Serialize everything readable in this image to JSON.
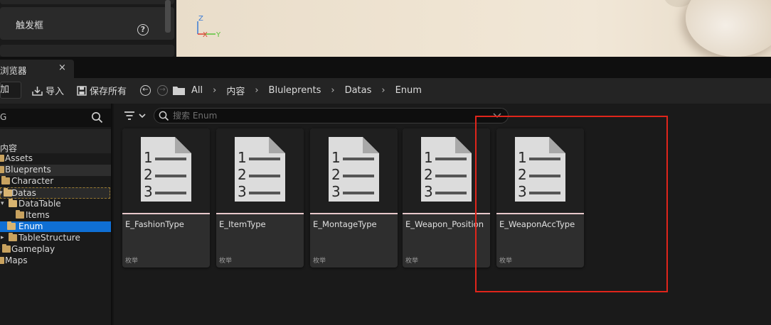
{
  "details_panel": {
    "trigger_label": "触发框",
    "help_icon": "help-icon"
  },
  "viewport": {
    "axis_z": "Z",
    "axis_x": "X",
    "axis_y": "Y",
    "colors": {
      "z": "#3a7bd5",
      "x": "#e03b2f",
      "y": "#5bc43a"
    }
  },
  "content_browser": {
    "tab_title": "浏览器",
    "tab_close": "×",
    "toolbar": {
      "add_label": "添加",
      "import_label": "导入",
      "save_all_label": "保存所有"
    },
    "breadcrumb": [
      "All",
      "内容",
      "Bluleprents",
      "Datas",
      "Enum"
    ],
    "breadcrumb_separator": "›"
  },
  "tree": {
    "search_text": "G",
    "root_label": "内容",
    "items": [
      {
        "label": "Assets",
        "state": "normal"
      },
      {
        "label": "Blueprents",
        "state": "highlight"
      },
      {
        "label": "Character",
        "state": "normal"
      },
      {
        "label": "Datas",
        "state": "outlined"
      },
      {
        "label": "DataTable",
        "state": "normal"
      },
      {
        "label": "Items",
        "state": "normal"
      },
      {
        "label": "Enum",
        "state": "selected"
      },
      {
        "label": "TableStructure",
        "state": "normal"
      },
      {
        "label": "Gameplay",
        "state": "normal"
      },
      {
        "label": "Maps",
        "state": "normal"
      }
    ]
  },
  "asset_view": {
    "search_placeholder": "搜索 Enum",
    "assets": [
      {
        "name": "E_FashionType",
        "type": "枚举"
      },
      {
        "name": "E_ItemType",
        "type": "枚举"
      },
      {
        "name": "E_MontageType",
        "type": "枚举"
      },
      {
        "name": "E_Weapon_Position",
        "type": "枚举"
      },
      {
        "name": "E_WeaponAccType",
        "type": "枚举"
      }
    ]
  },
  "annotation": {
    "color": "#e0251b"
  }
}
